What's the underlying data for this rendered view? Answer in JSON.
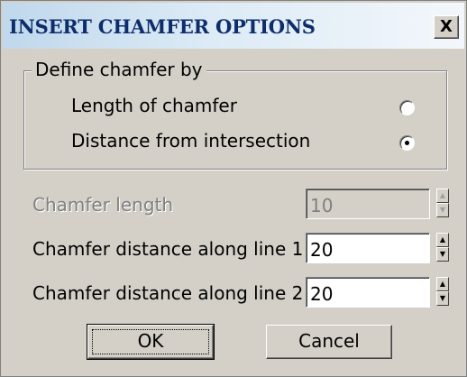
{
  "window": {
    "title": "INSERT CHAMFER OPTIONS",
    "close_label": "X"
  },
  "group": {
    "legend": "Define chamfer by",
    "options": [
      {
        "label": "Length of chamfer",
        "selected": false
      },
      {
        "label": "Distance from intersection",
        "selected": true
      }
    ]
  },
  "fields": [
    {
      "label": "Chamfer length",
      "value": "10",
      "enabled": false
    },
    {
      "label": "Chamfer distance along line 1",
      "value": "20",
      "enabled": true
    },
    {
      "label": "Chamfer distance along line 2",
      "value": "20",
      "enabled": true
    }
  ],
  "buttons": {
    "ok": "OK",
    "cancel": "Cancel"
  },
  "icons": {
    "spin_up": "spin-up-icon",
    "spin_down": "spin-down-icon"
  }
}
